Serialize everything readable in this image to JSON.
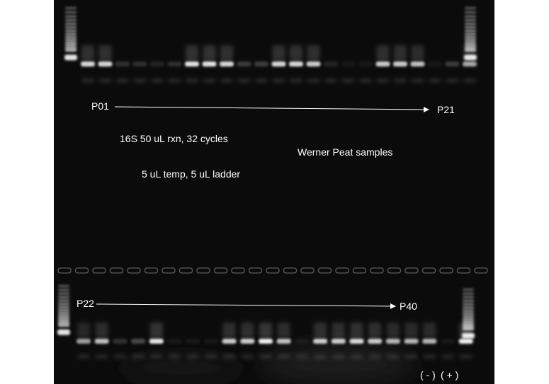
{
  "gel_image": {
    "labels": {
      "row1_start": "P01",
      "row1_end": "P21",
      "row2_start": "P22",
      "row2_end": "P40",
      "reaction": "16S 50 uL rxn, 32 cycles",
      "loading": "5 uL temp, 5 uL ladder",
      "samples": "Werner Peat samples",
      "neg_control": "( - )",
      "pos_control": "( + )"
    },
    "row1_band_intensity": [
      0.85,
      0.85,
      0.15,
      0.15,
      0.1,
      0.15,
      0.9,
      0.9,
      0.85,
      0.2,
      0.2,
      0.85,
      0.85,
      0.8,
      0.1,
      0.05,
      0.05,
      0.8,
      0.8,
      0.75,
      0.05,
      0.2,
      0.65
    ],
    "row2_band_intensity": [
      0.6,
      0.75,
      0.15,
      0.25,
      0.9,
      0.05,
      0.05,
      0.05,
      0.8,
      0.8,
      0.95,
      0.75,
      0.05,
      0.8,
      0.8,
      0.85,
      0.8,
      0.7,
      0.7,
      0.7,
      0.05,
      0.95
    ],
    "colors": {
      "gel_background": "#0b0b0b",
      "band": "#ffffff",
      "page_background": "#ffffff"
    }
  }
}
